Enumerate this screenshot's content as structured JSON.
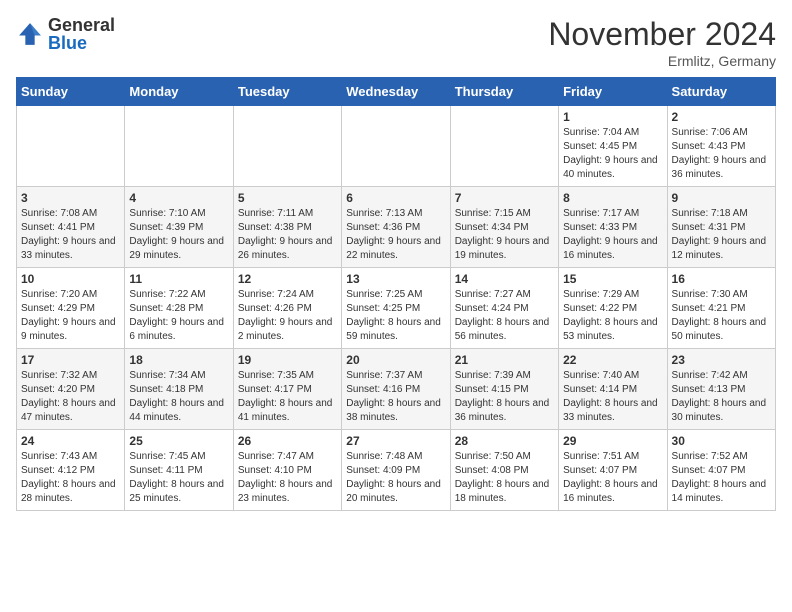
{
  "header": {
    "logo_general": "General",
    "logo_blue": "Blue",
    "month_title": "November 2024",
    "location": "Ermlitz, Germany"
  },
  "weekdays": [
    "Sunday",
    "Monday",
    "Tuesday",
    "Wednesday",
    "Thursday",
    "Friday",
    "Saturday"
  ],
  "weeks": [
    [
      {
        "day": "",
        "info": ""
      },
      {
        "day": "",
        "info": ""
      },
      {
        "day": "",
        "info": ""
      },
      {
        "day": "",
        "info": ""
      },
      {
        "day": "",
        "info": ""
      },
      {
        "day": "1",
        "info": "Sunrise: 7:04 AM\nSunset: 4:45 PM\nDaylight: 9 hours and 40 minutes."
      },
      {
        "day": "2",
        "info": "Sunrise: 7:06 AM\nSunset: 4:43 PM\nDaylight: 9 hours and 36 minutes."
      }
    ],
    [
      {
        "day": "3",
        "info": "Sunrise: 7:08 AM\nSunset: 4:41 PM\nDaylight: 9 hours and 33 minutes."
      },
      {
        "day": "4",
        "info": "Sunrise: 7:10 AM\nSunset: 4:39 PM\nDaylight: 9 hours and 29 minutes."
      },
      {
        "day": "5",
        "info": "Sunrise: 7:11 AM\nSunset: 4:38 PM\nDaylight: 9 hours and 26 minutes."
      },
      {
        "day": "6",
        "info": "Sunrise: 7:13 AM\nSunset: 4:36 PM\nDaylight: 9 hours and 22 minutes."
      },
      {
        "day": "7",
        "info": "Sunrise: 7:15 AM\nSunset: 4:34 PM\nDaylight: 9 hours and 19 minutes."
      },
      {
        "day": "8",
        "info": "Sunrise: 7:17 AM\nSunset: 4:33 PM\nDaylight: 9 hours and 16 minutes."
      },
      {
        "day": "9",
        "info": "Sunrise: 7:18 AM\nSunset: 4:31 PM\nDaylight: 9 hours and 12 minutes."
      }
    ],
    [
      {
        "day": "10",
        "info": "Sunrise: 7:20 AM\nSunset: 4:29 PM\nDaylight: 9 hours and 9 minutes."
      },
      {
        "day": "11",
        "info": "Sunrise: 7:22 AM\nSunset: 4:28 PM\nDaylight: 9 hours and 6 minutes."
      },
      {
        "day": "12",
        "info": "Sunrise: 7:24 AM\nSunset: 4:26 PM\nDaylight: 9 hours and 2 minutes."
      },
      {
        "day": "13",
        "info": "Sunrise: 7:25 AM\nSunset: 4:25 PM\nDaylight: 8 hours and 59 minutes."
      },
      {
        "day": "14",
        "info": "Sunrise: 7:27 AM\nSunset: 4:24 PM\nDaylight: 8 hours and 56 minutes."
      },
      {
        "day": "15",
        "info": "Sunrise: 7:29 AM\nSunset: 4:22 PM\nDaylight: 8 hours and 53 minutes."
      },
      {
        "day": "16",
        "info": "Sunrise: 7:30 AM\nSunset: 4:21 PM\nDaylight: 8 hours and 50 minutes."
      }
    ],
    [
      {
        "day": "17",
        "info": "Sunrise: 7:32 AM\nSunset: 4:20 PM\nDaylight: 8 hours and 47 minutes."
      },
      {
        "day": "18",
        "info": "Sunrise: 7:34 AM\nSunset: 4:18 PM\nDaylight: 8 hours and 44 minutes."
      },
      {
        "day": "19",
        "info": "Sunrise: 7:35 AM\nSunset: 4:17 PM\nDaylight: 8 hours and 41 minutes."
      },
      {
        "day": "20",
        "info": "Sunrise: 7:37 AM\nSunset: 4:16 PM\nDaylight: 8 hours and 38 minutes."
      },
      {
        "day": "21",
        "info": "Sunrise: 7:39 AM\nSunset: 4:15 PM\nDaylight: 8 hours and 36 minutes."
      },
      {
        "day": "22",
        "info": "Sunrise: 7:40 AM\nSunset: 4:14 PM\nDaylight: 8 hours and 33 minutes."
      },
      {
        "day": "23",
        "info": "Sunrise: 7:42 AM\nSunset: 4:13 PM\nDaylight: 8 hours and 30 minutes."
      }
    ],
    [
      {
        "day": "24",
        "info": "Sunrise: 7:43 AM\nSunset: 4:12 PM\nDaylight: 8 hours and 28 minutes."
      },
      {
        "day": "25",
        "info": "Sunrise: 7:45 AM\nSunset: 4:11 PM\nDaylight: 8 hours and 25 minutes."
      },
      {
        "day": "26",
        "info": "Sunrise: 7:47 AM\nSunset: 4:10 PM\nDaylight: 8 hours and 23 minutes."
      },
      {
        "day": "27",
        "info": "Sunrise: 7:48 AM\nSunset: 4:09 PM\nDaylight: 8 hours and 20 minutes."
      },
      {
        "day": "28",
        "info": "Sunrise: 7:50 AM\nSunset: 4:08 PM\nDaylight: 8 hours and 18 minutes."
      },
      {
        "day": "29",
        "info": "Sunrise: 7:51 AM\nSunset: 4:07 PM\nDaylight: 8 hours and 16 minutes."
      },
      {
        "day": "30",
        "info": "Sunrise: 7:52 AM\nSunset: 4:07 PM\nDaylight: 8 hours and 14 minutes."
      }
    ]
  ]
}
